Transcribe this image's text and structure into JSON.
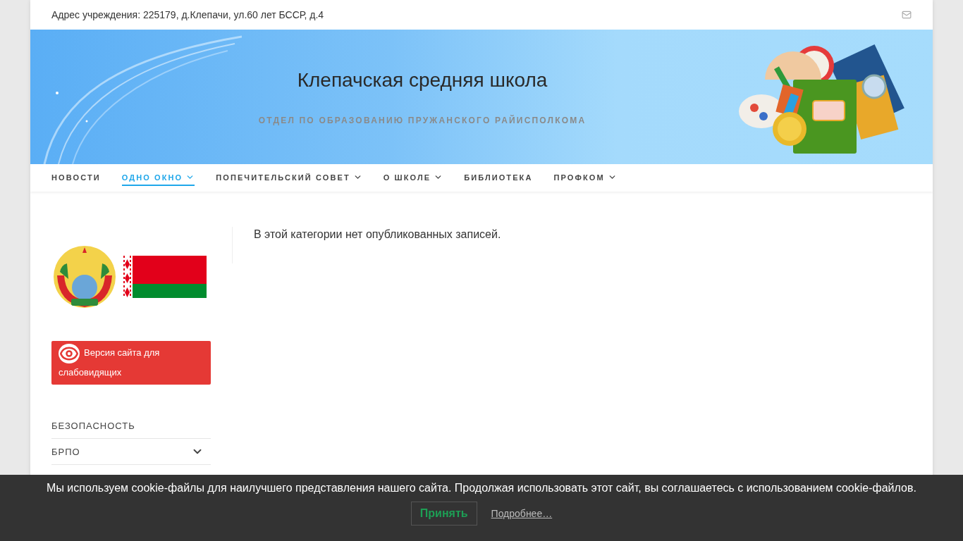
{
  "top_bar": {
    "address": "Адрес учреждения: 225179, д.Клепачи, ул.60 лет БССР, д.4"
  },
  "header": {
    "title": "Клепачская средняя школа",
    "subtitle": "ОТДЕЛ ПО ОБРАЗОВАНИЮ ПРУЖАНСКОГО РАЙИСПОЛКОМА"
  },
  "nav": [
    {
      "label": "НОВОСТИ",
      "selected": false,
      "has_submenu": false
    },
    {
      "label": "ОДНО ОКНО",
      "selected": true,
      "has_submenu": true
    },
    {
      "label": "ПОПЕЧИТЕЛЬСКИЙ СОВЕТ",
      "selected": false,
      "has_submenu": true
    },
    {
      "label": "О ШКОЛЕ",
      "selected": false,
      "has_submenu": true
    },
    {
      "label": "БИБЛИОТЕКА",
      "selected": false,
      "has_submenu": false
    },
    {
      "label": "ПРОФКОМ",
      "selected": false,
      "has_submenu": true
    }
  ],
  "sidebar": {
    "accessibility_button": "Версия сайта для слабовидящих",
    "menu": [
      {
        "label": "БЕЗОПАСНОСТЬ",
        "expandable": false
      },
      {
        "label": "БРПО",
        "expandable": true
      }
    ]
  },
  "content": {
    "message": "В этой категории нет опубликованных записей."
  },
  "cookie_banner": {
    "text": "Мы используем cookie-файлы для наилучшего представления нашего сайта. Продолжая использовать этот сайт, вы соглашаетесь с использованием cookie-файлов.",
    "accept": "Принять",
    "more": "Подробнее…"
  }
}
